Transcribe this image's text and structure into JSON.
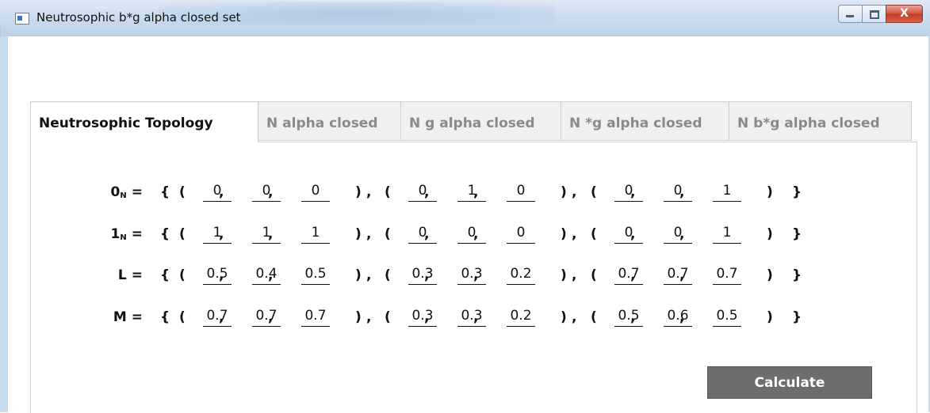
{
  "window": {
    "title": "Neutrosophic b*g alpha closed set",
    "close_glyph": "X"
  },
  "tabs": [
    {
      "label": "Neutrosophic Topology",
      "active": true
    },
    {
      "label": "N alpha closed",
      "active": false
    },
    {
      "label": "N g alpha closed",
      "active": false
    },
    {
      "label": "N *g alpha closed",
      "active": false
    },
    {
      "label": "N b*g alpha closed",
      "active": false
    }
  ],
  "rows": [
    {
      "name": "0",
      "sub": "N",
      "eq": "=",
      "triples": [
        [
          "0",
          "0",
          "0"
        ],
        [
          "0",
          "1",
          "0"
        ],
        [
          "0",
          "0",
          "1"
        ]
      ]
    },
    {
      "name": "1",
      "sub": "N",
      "eq": "=",
      "triples": [
        [
          "1",
          "1",
          "1"
        ],
        [
          "0",
          "0",
          "0"
        ],
        [
          "0",
          "0",
          "1"
        ]
      ]
    },
    {
      "name": "L",
      "sub": "",
      "eq": "=",
      "triples": [
        [
          "0.5",
          "0.4",
          "0.5"
        ],
        [
          "0.3",
          "0.3",
          "0.2"
        ],
        [
          "0.7",
          "0.7",
          "0.7"
        ]
      ]
    },
    {
      "name": "M",
      "sub": "",
      "eq": "=",
      "triples": [
        [
          "0.7",
          "0.7",
          "0.7"
        ],
        [
          "0.3",
          "0.3",
          "0.2"
        ],
        [
          "0.5",
          "0.6",
          "0.5"
        ]
      ]
    }
  ],
  "symbols": {
    "open_brace": "{",
    "close_brace": "}",
    "open_paren": "(",
    "close_paren": ")",
    "comma": ","
  },
  "calculate_label": "Calculate"
}
